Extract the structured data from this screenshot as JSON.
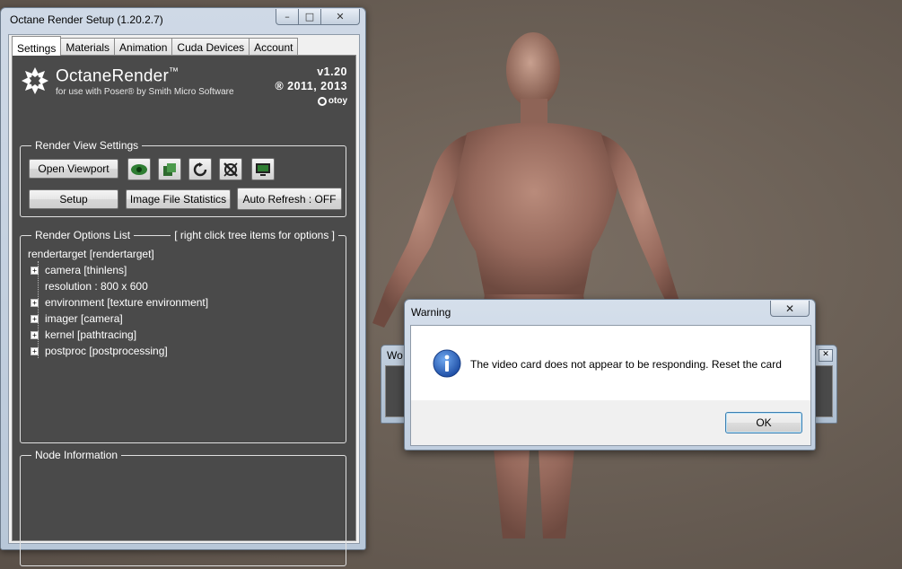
{
  "octane_window": {
    "title": "Octane Render Setup (1.20.2.7)",
    "tabs": [
      "Settings",
      "Materials",
      "Animation",
      "Cuda Devices",
      "Account"
    ],
    "active_tab": "Settings",
    "brand_name": "OctaneRender",
    "brand_tm": "™",
    "brand_subtitle": "for use with Poser® by Smith Micro Software",
    "version": "v1.20",
    "copyright": "® 2011, 2013",
    "otoy_label": "otoy",
    "render_view": {
      "label": "Render View Settings",
      "open_viewport": "Open Viewport",
      "setup": "Setup",
      "image_stats": "Image File Statistics",
      "auto_refresh": "Auto Refresh : OFF",
      "icon_buttons": [
        "eye-icon",
        "material-icon",
        "refresh-icon",
        "disable-icon",
        "monitor-icon"
      ]
    },
    "render_options": {
      "label": "Render Options List",
      "hint": "[ right click tree items for options ]",
      "root": "rendertarget   [rendertarget]",
      "items": [
        {
          "text": "camera   [thinlens]",
          "expandable": true
        },
        {
          "text": "resolution  :  800 x 600",
          "expandable": false
        },
        {
          "text": "environment   [texture environment]",
          "expandable": true
        },
        {
          "text": "imager   [camera]",
          "expandable": true
        },
        {
          "text": "kernel   [pathtracing]",
          "expandable": true
        },
        {
          "text": "postproc   [postprocessing]",
          "expandable": true
        }
      ]
    },
    "node_info": {
      "label": "Node Information"
    }
  },
  "background_window": {
    "title": "Wo"
  },
  "warning_dialog": {
    "title": "Warning",
    "close_glyph": "✕",
    "message": "The video card does not appear to be responding.  Reset the card",
    "ok_label": "OK"
  },
  "colors": {
    "panel_bg": "#4a4a4a",
    "desktop_bg": "#6b6056",
    "info_blue": "#1f5fbf"
  }
}
